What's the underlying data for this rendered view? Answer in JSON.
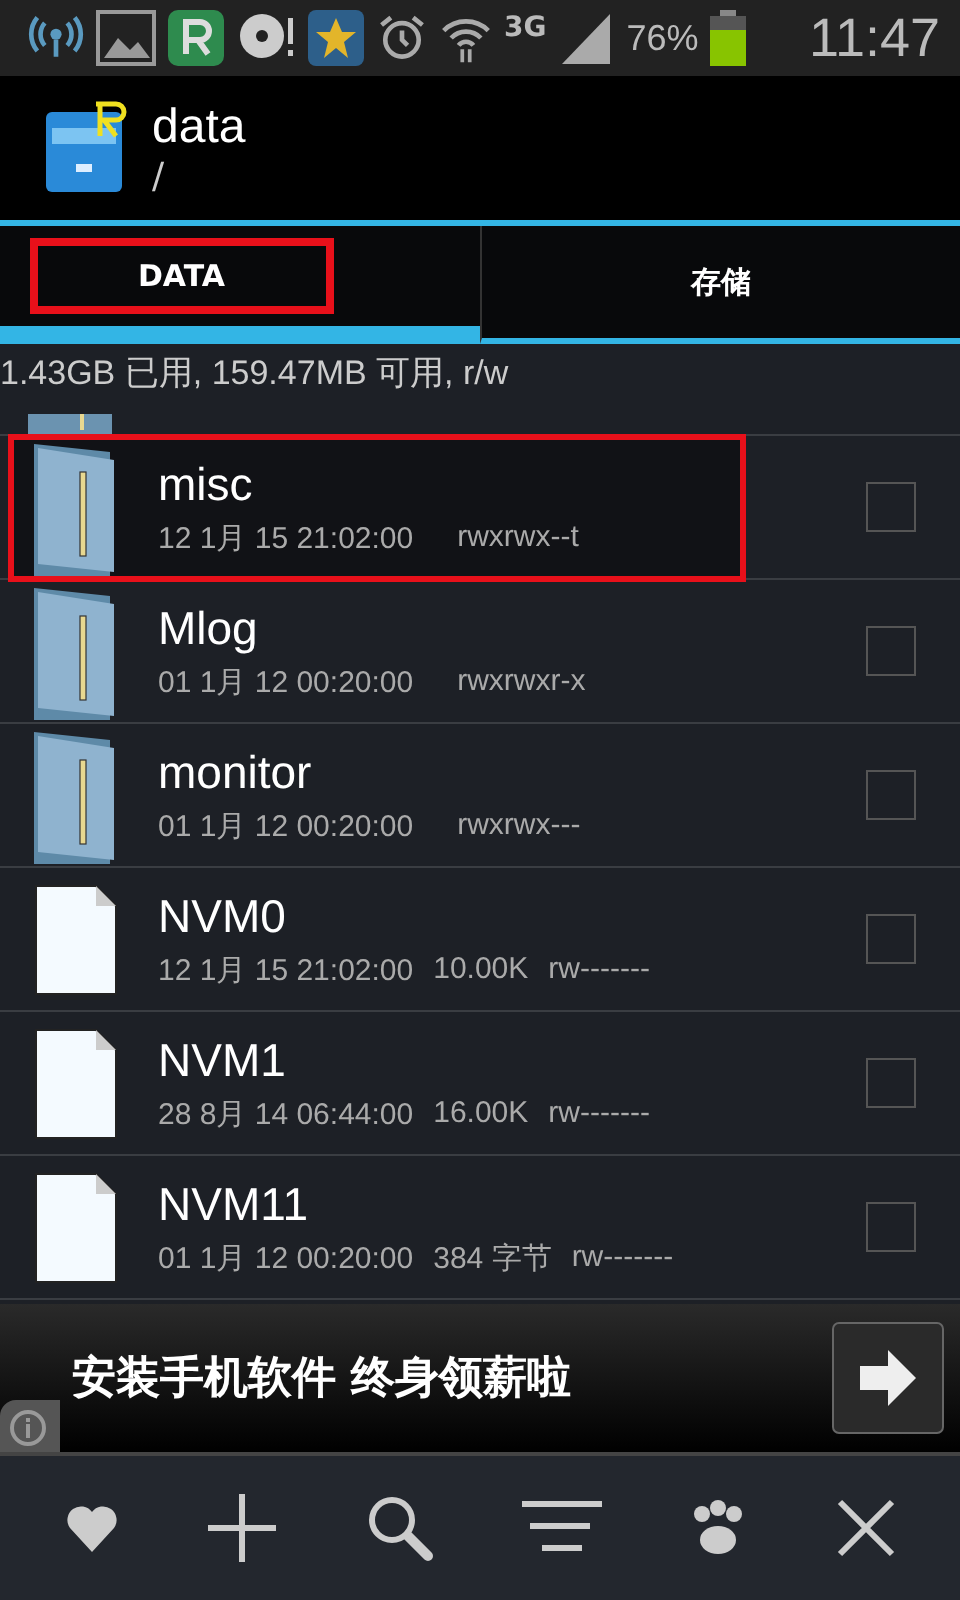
{
  "status_bar": {
    "network": "3G",
    "battery": "76%",
    "time": "11:47"
  },
  "header": {
    "title": "data",
    "path": "/"
  },
  "tabs": [
    {
      "label": "DATA",
      "selected": true,
      "highlighted": true
    },
    {
      "label": "存储",
      "selected": false,
      "highlighted": false
    }
  ],
  "storage_info": "1.43GB 已用, 159.47MB 可用, r/w",
  "files": [
    {
      "kind": "folder",
      "name": "misc",
      "date": "12 1月 15 21:02:00",
      "perms": "rwxrwx--t",
      "checked": false,
      "highlighted": true
    },
    {
      "kind": "folder",
      "name": "Mlog",
      "date": "01 1月 12 00:20:00",
      "perms": "rwxrwxr-x",
      "checked": false,
      "highlighted": false
    },
    {
      "kind": "folder",
      "name": "monitor",
      "date": "01 1月 12 00:20:00",
      "perms": "rwxrwx---",
      "checked": false,
      "highlighted": false
    },
    {
      "kind": "file",
      "name": "NVM0",
      "date": "12 1月 15 21:02:00",
      "size": "10.00K",
      "perms": "rw-------",
      "checked": false,
      "highlighted": false
    },
    {
      "kind": "file",
      "name": "NVM1",
      "date": "28 8月 14 06:44:00",
      "size": "16.00K",
      "perms": "rw-------",
      "checked": false,
      "highlighted": false
    },
    {
      "kind": "file",
      "name": "NVM11",
      "date": "01 1月 12 00:20:00",
      "size": "384 字节",
      "perms": "rw-------",
      "checked": false,
      "highlighted": false
    }
  ],
  "ad": {
    "text": "安装手机软件 终身领薪啦"
  }
}
